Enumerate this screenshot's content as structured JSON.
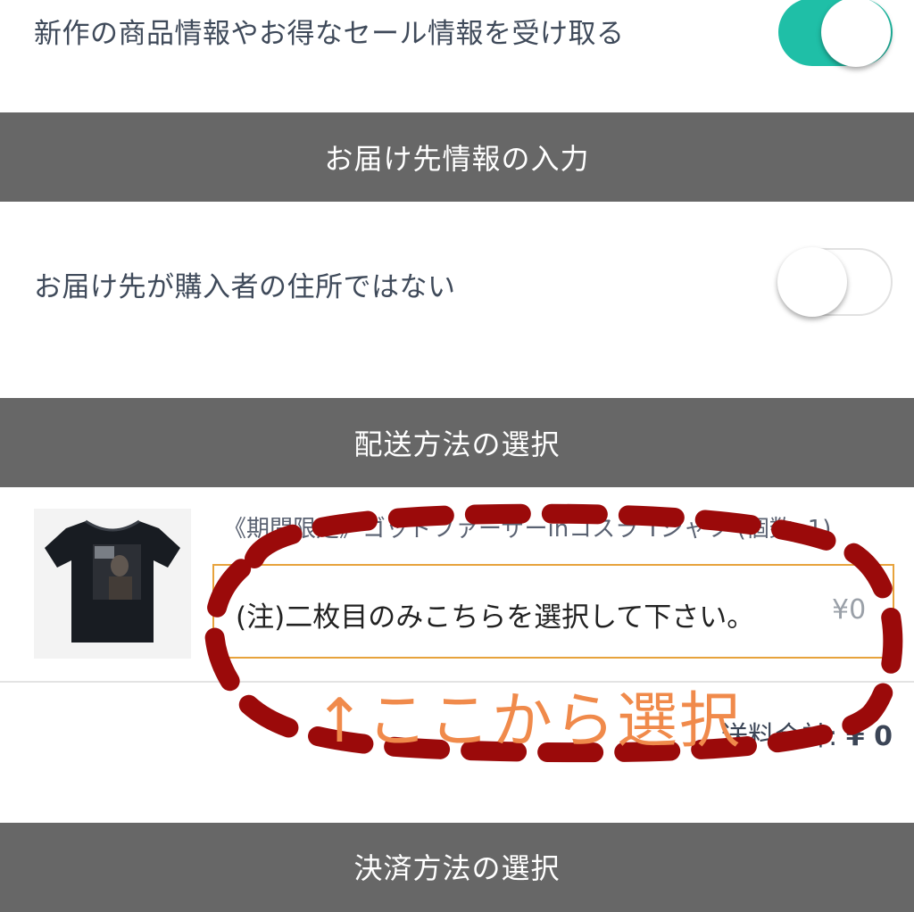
{
  "notifications": {
    "label": "新作の商品情報やお得なセール情報を受け取る",
    "toggle_on": true,
    "toggle_color": "#1fbfa7"
  },
  "delivery_section": {
    "header": "お届け先情報の入力",
    "option_label": "お届け先が購入者の住所ではない",
    "toggle_on": false
  },
  "shipping_section": {
    "header": "配送方法の選択",
    "product_title": "《期間限定》ゴッドファーザーinコスラ Tシャツ (個数: 1)",
    "selected_option": "(注)二枚目のみこちらを選択して下さい。",
    "selected_price": "¥0",
    "total_label": "送料合計:",
    "total_value": "¥ 0"
  },
  "payment_section": {
    "header": "決済方法の選択"
  },
  "annotation": {
    "text": "↑ここから選択",
    "text_color": "#f08a4b",
    "outline_color": "#9b0a0a"
  },
  "colors": {
    "header_bg": "#676767",
    "select_border": "#e7a33c"
  }
}
